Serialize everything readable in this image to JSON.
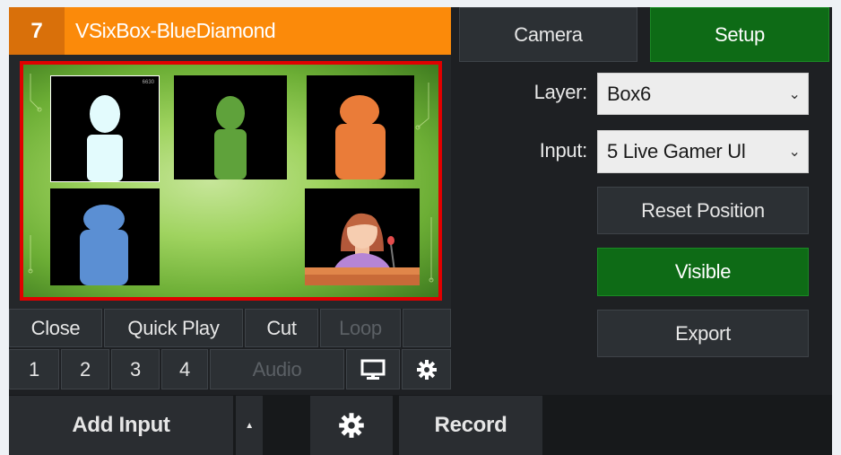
{
  "input": {
    "number": "7",
    "title": "VSixBox-BlueDiamond"
  },
  "tabs": {
    "camera": "Camera",
    "setup": "Setup"
  },
  "settings": {
    "layer_label": "Layer:",
    "layer_value": "Box6",
    "input_label": "Input:",
    "input_value": "5 Live Gamer Ul",
    "reset_position": "Reset Position",
    "visible": "Visible",
    "export": "Export"
  },
  "controls": {
    "close": "Close",
    "quick_play": "Quick Play",
    "cut": "Cut",
    "loop": "Loop",
    "overlay_1": "1",
    "overlay_2": "2",
    "overlay_3": "3",
    "overlay_4": "4",
    "audio": "Audio"
  },
  "preview": {
    "tile1_caption": "6630"
  },
  "bottom": {
    "add_input": "Add Input",
    "record": "Record"
  },
  "colors": {
    "accent_orange": "#fb8a0a",
    "active_green": "#0e6b16",
    "preview_border": "#e00000"
  },
  "icons": [
    "monitor-icon",
    "gear-icon",
    "caret-up-icon",
    "gear-icon"
  ]
}
